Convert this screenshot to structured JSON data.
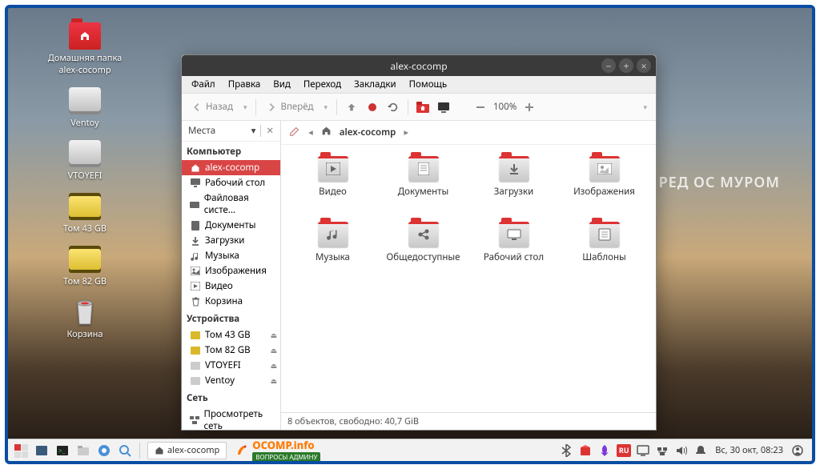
{
  "desktop_icons": [
    {
      "label": "Домашняя папка\nalex-cocomp",
      "type": "home"
    },
    {
      "label": "Ventoy",
      "type": "drive"
    },
    {
      "label": "VTOYEFI",
      "type": "drive"
    },
    {
      "label": "Том 43 GB",
      "type": "drive-y"
    },
    {
      "label": "Том 82 GB",
      "type": "drive-y"
    },
    {
      "label": "Корзина",
      "type": "trash"
    }
  ],
  "watermark": "РЕД ОС МУРОМ",
  "window": {
    "title": "alex-cocomp",
    "menu": [
      "Файл",
      "Правка",
      "Вид",
      "Переход",
      "Закладки",
      "Помощь"
    ],
    "toolbar": {
      "back": "Назад",
      "forward": "Вперёд",
      "zoom": "100%"
    },
    "sidebar": {
      "header": "Места",
      "sections": [
        {
          "title": "Компьютер",
          "items": [
            {
              "label": "alex-cocomp",
              "icon": "home",
              "active": true
            },
            {
              "label": "Рабочий стол",
              "icon": "desktop"
            },
            {
              "label": "Файловая систе...",
              "icon": "fs"
            },
            {
              "label": "Документы",
              "icon": "doc"
            },
            {
              "label": "Загрузки",
              "icon": "down"
            },
            {
              "label": "Музыка",
              "icon": "music"
            },
            {
              "label": "Изображения",
              "icon": "img"
            },
            {
              "label": "Видео",
              "icon": "vid"
            },
            {
              "label": "Корзина",
              "icon": "trash"
            }
          ]
        },
        {
          "title": "Устройства",
          "items": [
            {
              "label": "Том 43 GB",
              "icon": "vol",
              "eject": true
            },
            {
              "label": "Том 82 GB",
              "icon": "vol",
              "eject": true
            },
            {
              "label": "VTOYEFI",
              "icon": "disk",
              "eject": true
            },
            {
              "label": "Ventoy",
              "icon": "disk",
              "eject": true
            }
          ]
        },
        {
          "title": "Сеть",
          "items": [
            {
              "label": "Просмотреть сеть",
              "icon": "net"
            }
          ]
        }
      ]
    },
    "path": "alex-cocomp",
    "files": [
      {
        "label": "Видео",
        "glyph": "play"
      },
      {
        "label": "Документы",
        "glyph": "doc"
      },
      {
        "label": "Загрузки",
        "glyph": "down"
      },
      {
        "label": "Изображения",
        "glyph": "img"
      },
      {
        "label": "Музыка",
        "glyph": "music"
      },
      {
        "label": "Общедоступные",
        "glyph": "share"
      },
      {
        "label": "Рабочий стол",
        "glyph": "desk"
      },
      {
        "label": "Шаблоны",
        "glyph": "tmpl"
      }
    ],
    "status": "8 объектов, свободно: 40,7 GiB"
  },
  "taskbar": {
    "active_task": "alex-cocomp",
    "ocomp": {
      "top": "OCOMP.info",
      "bottom": "ВОПРОСЫ АДМИНУ"
    },
    "lang": "RU",
    "datetime": "Вс, 30 окт, 08:23"
  }
}
